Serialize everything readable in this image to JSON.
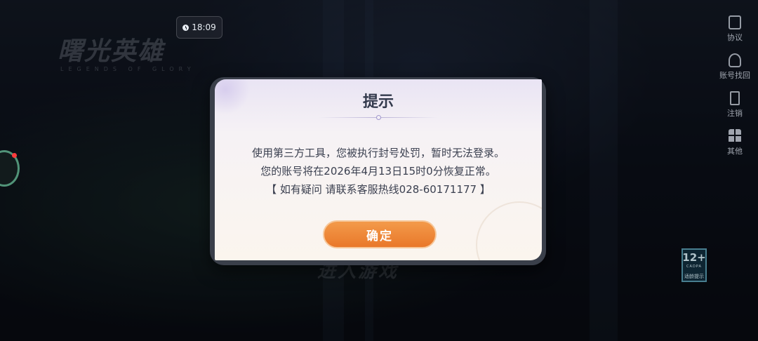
{
  "status": {
    "time": "18:09"
  },
  "logo": {
    "title": "曙光英雄",
    "subtitle": "LEGENDS OF GLORY"
  },
  "right_menu": {
    "items": [
      {
        "label": "协议",
        "icon": "agreement-icon"
      },
      {
        "label": "账号找回",
        "icon": "account-recovery-icon"
      },
      {
        "label": "注销",
        "icon": "logout-icon"
      },
      {
        "label": "其他",
        "icon": "grid-icon"
      }
    ]
  },
  "age_rating": {
    "value": "12+",
    "sub": "CADPA",
    "label": "适龄提示"
  },
  "background": {
    "enter_game": "进入游戏"
  },
  "dialog": {
    "title": "提示",
    "lines": [
      "使用第三方工具，您被执行封号处罚，暂时无法登录。",
      "您的账号将在2026年4月13日15时0分恢复正常。",
      "【 如有疑问 请联系客服热线028-60171177 】"
    ],
    "confirm_label": "确定"
  },
  "colors": {
    "accent": "#e9782a",
    "dialog_title": "#333a4c",
    "text": "#3b4050"
  }
}
